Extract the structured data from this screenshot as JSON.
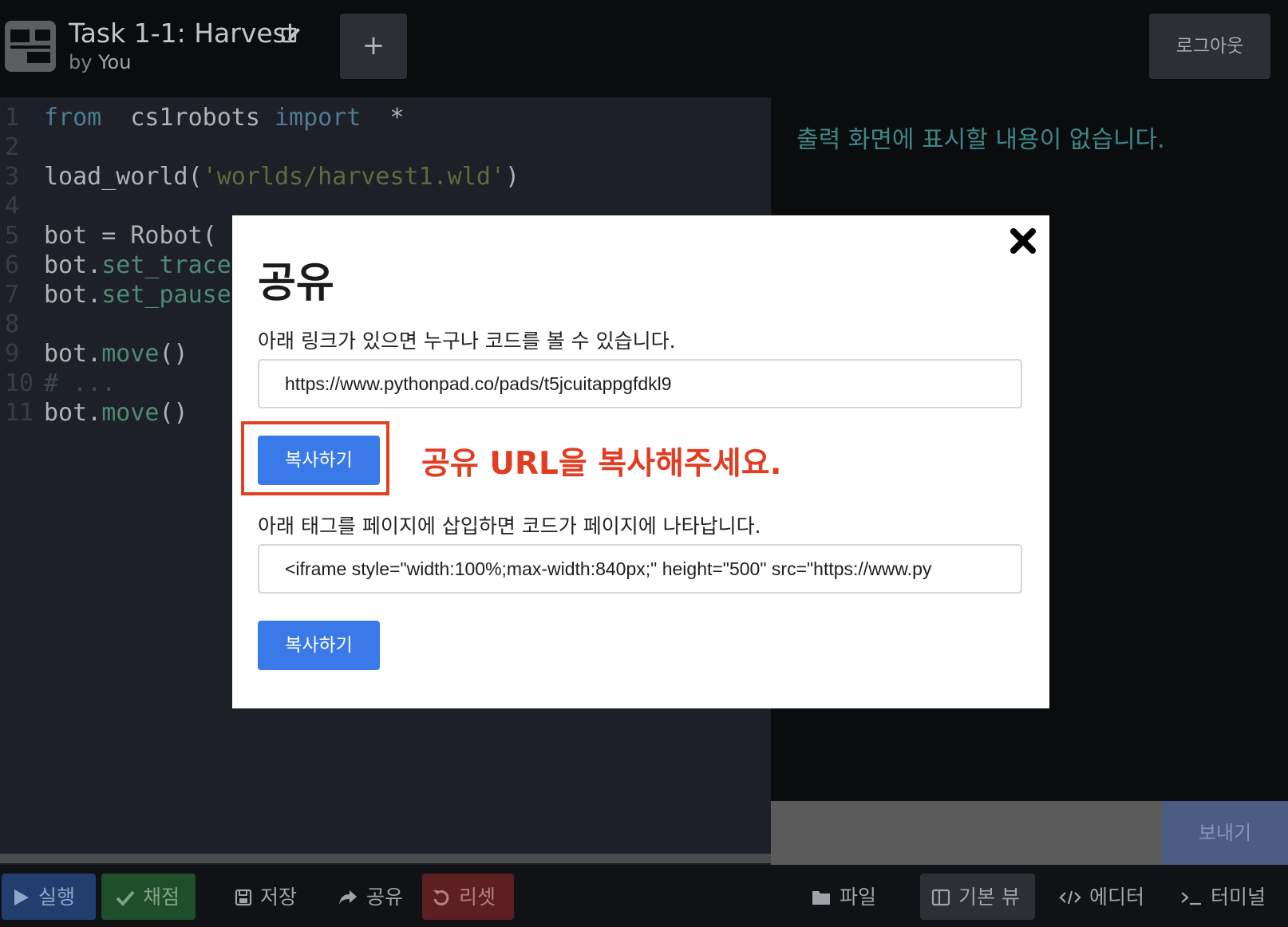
{
  "header": {
    "title": "Task 1-1: Harvest",
    "by_label": "by",
    "author": "You",
    "add_label": "+",
    "logout_label": "로그아웃"
  },
  "editor": {
    "lines": [
      {
        "num": "1",
        "parts": [
          [
            "kw",
            "from"
          ],
          [
            "",
            "  cs1robots "
          ],
          [
            "kw",
            "import"
          ],
          [
            "",
            "  *"
          ]
        ]
      },
      {
        "num": "2",
        "parts": []
      },
      {
        "num": "3",
        "parts": [
          [
            "",
            "load_world("
          ],
          [
            "str",
            "'worlds/harvest1.wld'"
          ],
          [
            "",
            ")"
          ]
        ]
      },
      {
        "num": "4",
        "parts": []
      },
      {
        "num": "5",
        "parts": [
          [
            "",
            "bot = Robot("
          ]
        ]
      },
      {
        "num": "6",
        "parts": [
          [
            "",
            "bot."
          ],
          [
            "meth",
            "set_trace"
          ]
        ]
      },
      {
        "num": "7",
        "parts": [
          [
            "",
            "bot."
          ],
          [
            "meth",
            "set_pause"
          ]
        ]
      },
      {
        "num": "8",
        "parts": []
      },
      {
        "num": "9",
        "parts": [
          [
            "",
            "bot."
          ],
          [
            "meth",
            "move"
          ],
          [
            "",
            "()"
          ]
        ]
      },
      {
        "num": "10",
        "parts": [
          [
            "cmt",
            "# ..."
          ]
        ]
      },
      {
        "num": "11",
        "parts": [
          [
            "",
            "bot."
          ],
          [
            "meth",
            "move"
          ],
          [
            "",
            "()"
          ]
        ]
      }
    ]
  },
  "output": {
    "empty_message": "출력 화면에 표시할 내용이 없습니다.",
    "send_label": "보내기"
  },
  "toolbar": {
    "run": "실행",
    "grade": "채점",
    "save": "저장",
    "share": "공유",
    "reset": "리셋",
    "files": "파일",
    "default_view": "기본 뷰",
    "editor": "에디터",
    "terminal": "터미널"
  },
  "share_modal": {
    "title": "공유",
    "link_desc": "아래 링크가 있으면 누구나 코드를 볼 수 있습니다.",
    "link_value": "https://www.pythonpad.co/pads/t5jcuitappgfdkl9",
    "copy_label": "복사하기",
    "annotation": "공유 URL을 복사해주세요.",
    "embed_desc": "아래 태그를 페이지에 삽입하면 코드가 페이지에 나타납니다.",
    "embed_value": "<iframe style=\"width:100%;max-width:840px;\" height=\"500\" src=\"https://www.py",
    "copy_label_2": "복사하기"
  },
  "colors": {
    "accent_blue": "#3a79e8",
    "annotation_red": "#e03d22",
    "run_bg": "#223e6e",
    "grade_bg": "#1f4f2a",
    "reset_bg": "#5e1f22"
  },
  "icons": [
    "edit-icon",
    "plus-icon",
    "play-icon",
    "check-icon",
    "save-icon",
    "share-icon",
    "reset-icon",
    "folder-icon",
    "layout-icon",
    "code-icon",
    "terminal-icon",
    "close-icon"
  ]
}
